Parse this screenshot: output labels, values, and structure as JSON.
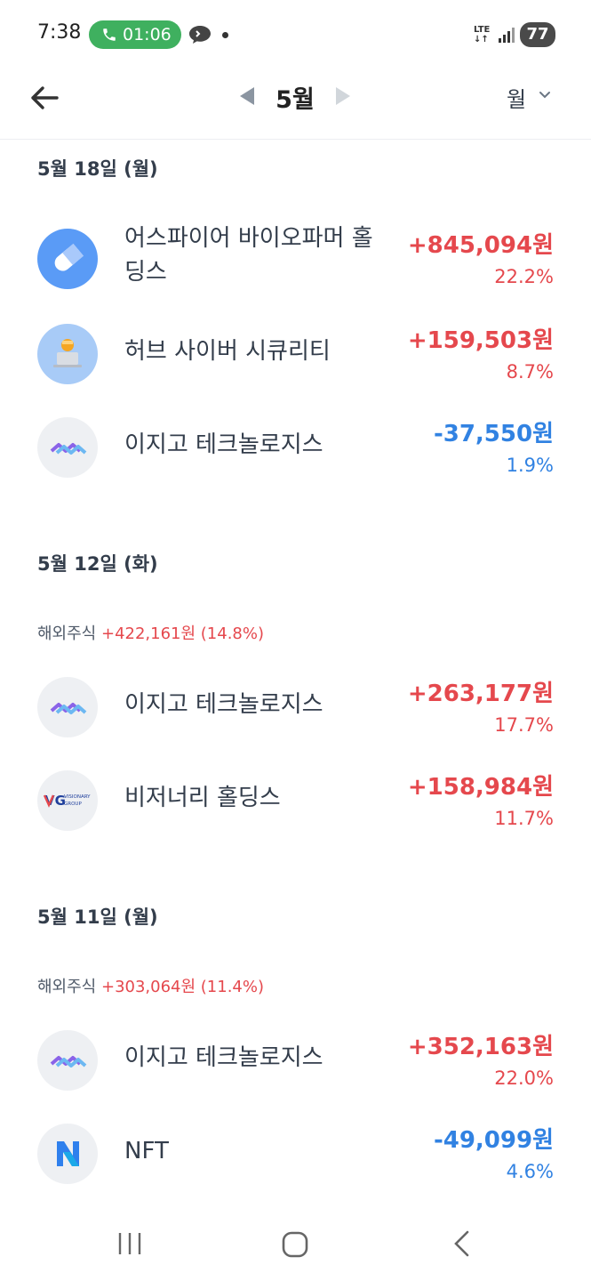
{
  "status_bar": {
    "time": "7:38",
    "call_timer": "01:06",
    "network": "LTE",
    "battery": "77"
  },
  "header": {
    "month": "5월",
    "period": "월"
  },
  "sections": [
    {
      "date": "5월 18일 (월)",
      "items": [
        {
          "name": "어스파이어 바이오파머 홀딩스",
          "amount": "+845,094원",
          "percent": "22.2%",
          "direction": "up",
          "logo": "pill-icon"
        },
        {
          "name": "허브 사이버 시큐리티",
          "amount": "+159,503원",
          "percent": "8.7%",
          "direction": "up",
          "logo": "laptop-person-icon"
        },
        {
          "name": "이지고 테크놀로지스",
          "amount": "-37,550원",
          "percent": "1.9%",
          "direction": "down",
          "logo": "wave-logo-icon"
        }
      ]
    },
    {
      "date": "5월 12일 (화)",
      "summary_label": "해외주식",
      "summary_value": "+422,161원 (14.8%)",
      "items": [
        {
          "name": "이지고 테크놀로지스",
          "amount": "+263,177원",
          "percent": "17.7%",
          "direction": "up",
          "logo": "wave-logo-icon"
        },
        {
          "name": "비저너리 홀딩스",
          "amount": "+158,984원",
          "percent": "11.7%",
          "direction": "up",
          "logo": "vg-logo-icon",
          "logo_text": "VG",
          "logo_subtext_1": "VISIONARY",
          "logo_subtext_2": "GROUP"
        }
      ]
    },
    {
      "date": "5월 11일 (월)",
      "summary_label": "해외주식",
      "summary_value": "+303,064원 (11.4%)",
      "items": [
        {
          "name": "이지고 테크놀로지스",
          "amount": "+352,163원",
          "percent": "22.0%",
          "direction": "up",
          "logo": "wave-logo-icon"
        },
        {
          "name": "NFT",
          "amount": "-49,099원",
          "percent": "4.6%",
          "direction": "down",
          "logo": "n-logo-icon"
        }
      ]
    }
  ],
  "colors": {
    "up": "#e5484d",
    "down": "#3182e2",
    "text": "#333d4b",
    "call_green": "#3fb05f"
  }
}
